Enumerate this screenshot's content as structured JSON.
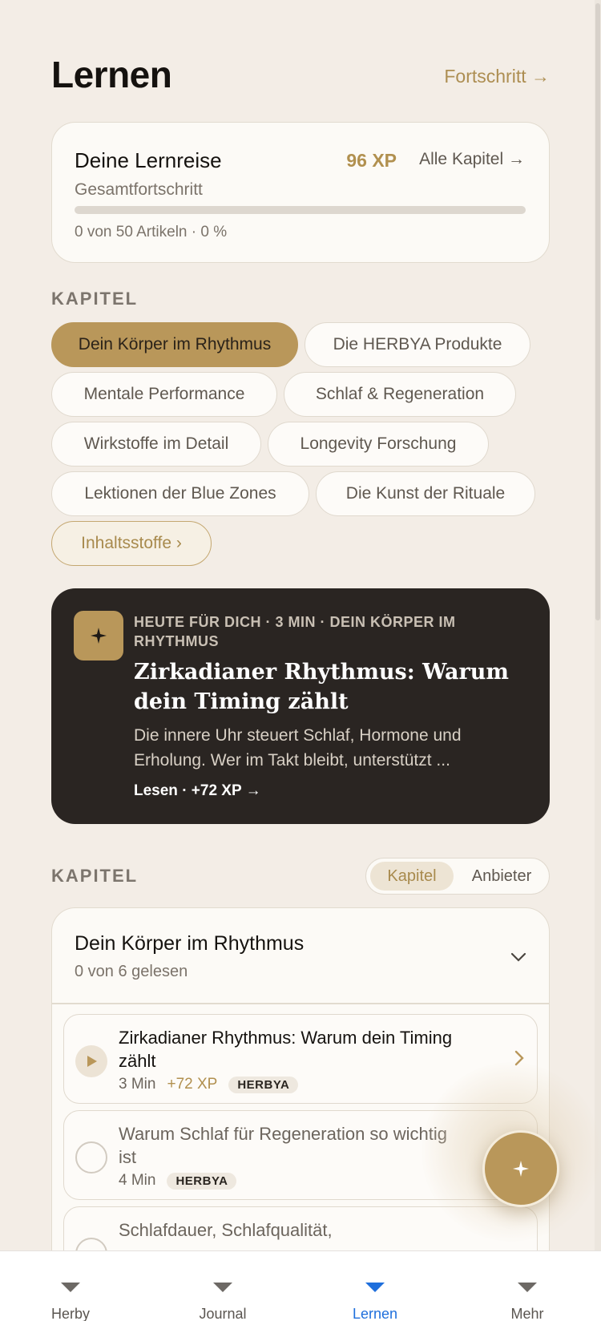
{
  "header": {
    "title": "Lernen",
    "progress_link": "Fortschritt →"
  },
  "journey": {
    "title": "Deine Lernreise",
    "xp": "96 XP",
    "all_chapters": "Alle Kapitel →",
    "subtitle": "Gesamtfortschritt",
    "progress_fraction": 0,
    "meta": "0 von 50 Artikeln · 0 %"
  },
  "chapters_section": {
    "label": "KAPITEL",
    "chips": [
      {
        "label": "Dein Körper im Rhythmus",
        "active": true
      },
      {
        "label": "Die HERBYA Produkte",
        "active": false
      },
      {
        "label": "Mentale Performance",
        "active": false
      },
      {
        "label": "Schlaf & Regeneration",
        "active": false
      },
      {
        "label": "Wirkstoffe im Detail",
        "active": false
      },
      {
        "label": "Longevity Forschung",
        "active": false
      },
      {
        "label": "Lektionen der Blue Zones",
        "active": false
      },
      {
        "label": "Die Kunst der Rituale",
        "active": false
      },
      {
        "label": "Inhaltsstoffe ›",
        "active": false
      }
    ]
  },
  "featured": {
    "icon": "sparkle-icon",
    "tag": "HEUTE FÜR DICH · 3 MIN · DEIN KÖRPER IM RHYTHMUS",
    "title": "Zirkadianer Rhythmus: Warum dein Timing zählt",
    "description": "Die innere Uhr steuert Schlaf, Hormone und Erholung. Wer im Takt bleibt, unterstützt ...",
    "cta": "Lesen · +72 XP →"
  },
  "chapter_list": {
    "label": "KAPITEL",
    "toggle": {
      "active": "Kapitel",
      "inactive": "Anbieter"
    },
    "card": {
      "title": "Dein Körper im Rhythmus",
      "subtitle": "0 von 6 gelesen",
      "lessons": [
        {
          "title": "Zirkadianer Rhythmus: Warum dein Timing zählt",
          "duration": "3 Min",
          "xp": "+72 XP",
          "badge": "HERBYA",
          "state": "current"
        },
        {
          "title": "Warum Schlaf für Regeneration so wichtig ist",
          "duration": "4 Min",
          "xp": "",
          "badge": "HERBYA",
          "state": "unread"
        },
        {
          "title": "Schlafdauer, Schlafqualität,",
          "duration": "",
          "xp": "",
          "badge": "",
          "state": "unread"
        }
      ]
    }
  },
  "fab": {
    "icon": "sparkle-icon"
  },
  "bottom_nav": [
    {
      "label": "Herby",
      "active": false
    },
    {
      "label": "Journal",
      "active": false
    },
    {
      "label": "Lernen",
      "active": true
    },
    {
      "label": "Mehr",
      "active": false
    }
  ],
  "colors": {
    "background": "#f3ede6",
    "accent_gold": "#b9975a",
    "featured_dark": "#2a2522",
    "nav_active": "#1f6fdc"
  }
}
